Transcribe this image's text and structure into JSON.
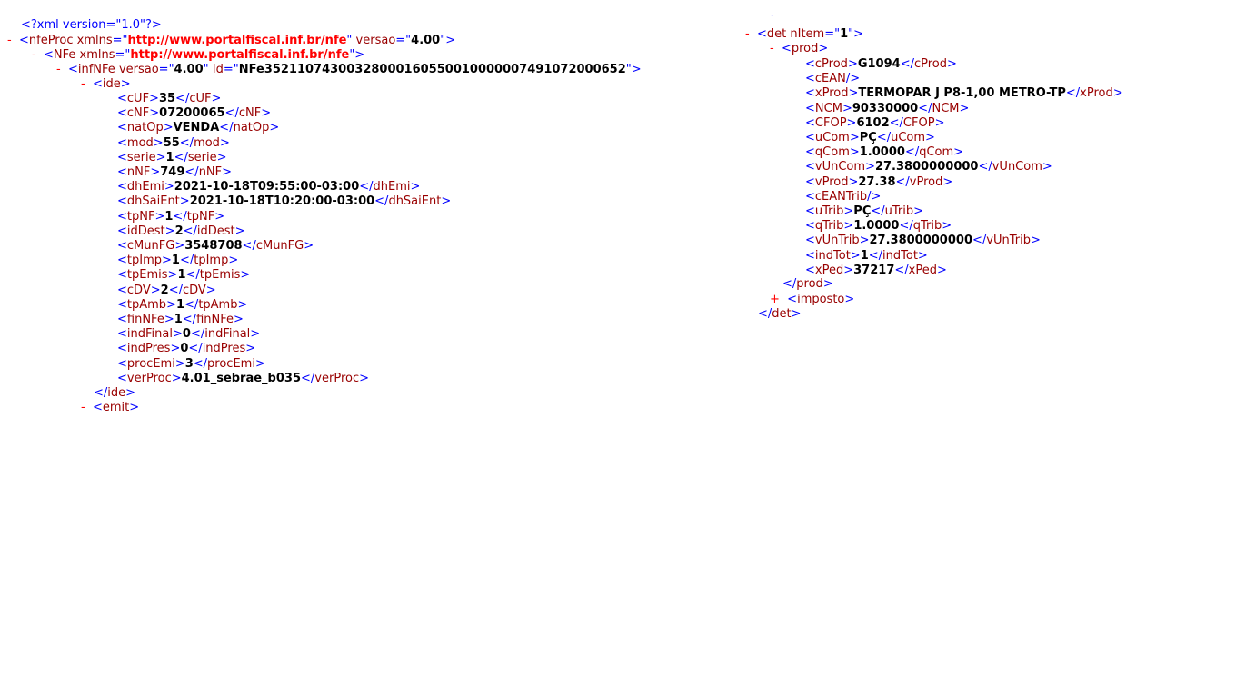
{
  "left": {
    "decl": "<?xml version=\"1.0\"?>",
    "nfeProc": {
      "tag": "nfeProc",
      "attr1": "xmlns",
      "val1": "http://www.portalfiscal.inf.br/nfe",
      "attr2": "versao",
      "val2": "4.00"
    },
    "nfe": {
      "tag": "NFe",
      "attr1": "xmlns",
      "val1": "http://www.portalfiscal.inf.br/nfe"
    },
    "infNFe": {
      "tag": "infNFe",
      "attr1": "versao",
      "val1": "4.00",
      "attr2": "Id",
      "val2": "NFe35211074300328000160550010000007491072000652"
    },
    "ide_open": "ide",
    "ide": [
      {
        "tag": "cUF",
        "value": "35"
      },
      {
        "tag": "cNF",
        "value": "07200065"
      },
      {
        "tag": "natOp",
        "value": "VENDA"
      },
      {
        "tag": "mod",
        "value": "55"
      },
      {
        "tag": "serie",
        "value": "1"
      },
      {
        "tag": "nNF",
        "value": "749"
      },
      {
        "tag": "dhEmi",
        "value": "2021-10-18T09:55:00-03:00"
      },
      {
        "tag": "dhSaiEnt",
        "value": "2021-10-18T10:20:00-03:00"
      },
      {
        "tag": "tpNF",
        "value": "1"
      },
      {
        "tag": "idDest",
        "value": "2"
      },
      {
        "tag": "cMunFG",
        "value": "3548708"
      },
      {
        "tag": "tpImp",
        "value": "1"
      },
      {
        "tag": "tpEmis",
        "value": "1"
      },
      {
        "tag": "cDV",
        "value": "2"
      },
      {
        "tag": "tpAmb",
        "value": "1"
      },
      {
        "tag": "finNFe",
        "value": "1"
      },
      {
        "tag": "indFinal",
        "value": "0"
      },
      {
        "tag": "indPres",
        "value": "0"
      },
      {
        "tag": "procEmi",
        "value": "3"
      },
      {
        "tag": "verProc",
        "value": "4.01_sebrae_b035"
      }
    ],
    "ide_close": "ide",
    "emit_open": "emit"
  },
  "right": {
    "det": {
      "tag": "det",
      "attr": "nItem",
      "val": "1"
    },
    "prod_open": "prod",
    "prod": [
      {
        "tag": "cProd",
        "value": "G1094"
      },
      {
        "tag": "cEAN",
        "value": "",
        "empty": true
      },
      {
        "tag": "xProd",
        "value": "TERMOPAR J P8-1,00 METRO-TP"
      },
      {
        "tag": "NCM",
        "value": "90330000"
      },
      {
        "tag": "CFOP",
        "value": "6102"
      },
      {
        "tag": "uCom",
        "value": "PÇ"
      },
      {
        "tag": "qCom",
        "value": "1.0000"
      },
      {
        "tag": "vUnCom",
        "value": "27.3800000000"
      },
      {
        "tag": "vProd",
        "value": "27.38"
      },
      {
        "tag": "cEANTrib",
        "value": "",
        "empty": true
      },
      {
        "tag": "uTrib",
        "value": "PÇ"
      },
      {
        "tag": "qTrib",
        "value": "1.0000"
      },
      {
        "tag": "vUnTrib",
        "value": "27.3800000000"
      },
      {
        "tag": "indTot",
        "value": "1"
      },
      {
        "tag": "xPed",
        "value": "37217"
      }
    ],
    "prod_close": "prod",
    "imposto": "imposto",
    "det_close": "det"
  },
  "markers": {
    "minus": "-",
    "plus": "+"
  }
}
